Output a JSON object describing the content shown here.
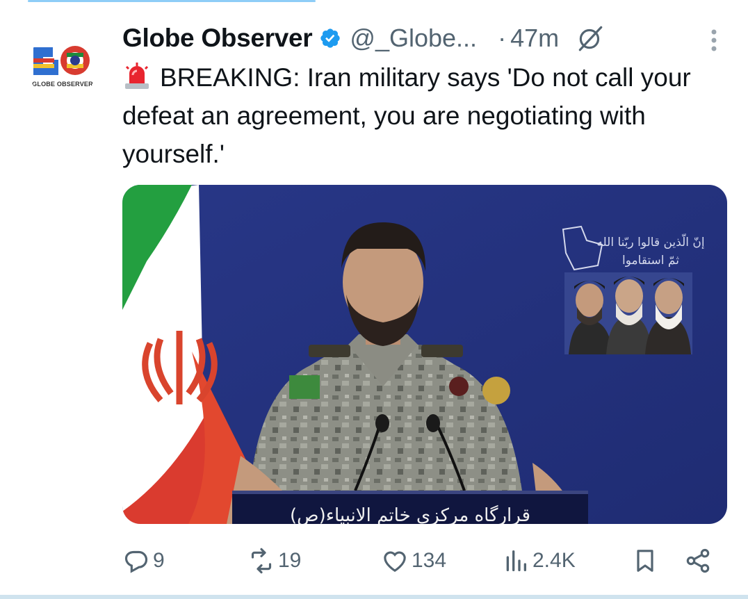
{
  "tweet": {
    "author_name": "Globe Observer",
    "handle": "@_Globe...",
    "separator": "·",
    "time": "47m",
    "avatar_caption": "GLOBE OBSERVER",
    "text_emoji_icon": "police-light-icon",
    "text": "BREAKING: Iran military says 'Do not call your defeat an agreement, you are negotiating with yourself.'",
    "media": {
      "podium_text": "قرارگاه مرکزی خاتم الانبیاء(ص)",
      "banner_text_1": "إنّ الّذين قالوا ربّنا الله",
      "banner_text_2": "ثمّ استقاموا"
    }
  },
  "actions": {
    "replies": "9",
    "reposts": "19",
    "likes": "134",
    "views": "2.4K"
  },
  "colors": {
    "text": "#0f1419",
    "secondary": "#536471",
    "verified": "#1d9bf0",
    "media_background": "#2b3a8c"
  }
}
